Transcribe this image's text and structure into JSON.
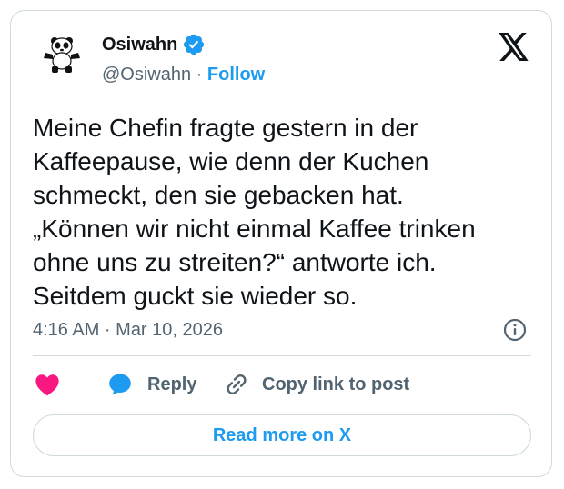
{
  "author": {
    "display_name": "Osiwahn",
    "handle": "@Osiwahn",
    "separator": " · ",
    "follow_label": "Follow"
  },
  "tweet": {
    "lines": [
      "Meine Chefin fragte gestern in der",
      "Kaffeepause, wie denn der Kuchen",
      "schmeckt, den sie gebacken hat.",
      "„Können wir nicht einmal Kaffee trinken",
      "ohne uns zu streiten?“ antworte ich.",
      "Seitdem guckt sie wieder so."
    ],
    "timestamp": "4:16 AM · Mar 10, 2026"
  },
  "actions": {
    "reply_label": "Reply",
    "copy_label": "Copy link to post",
    "read_more_label": "Read more on X"
  },
  "icons": {
    "avatar": "panda-avatar-icon",
    "verified": "verified-badge-icon",
    "logo": "x-logo-icon",
    "info": "info-icon",
    "like": "heart-icon",
    "reply": "speech-bubble-icon",
    "copy": "link-icon"
  },
  "colors": {
    "accent": "#1d9bf0",
    "like": "#f91880",
    "muted_text": "#536471",
    "border": "#cfd9de",
    "text": "#0f1419"
  }
}
